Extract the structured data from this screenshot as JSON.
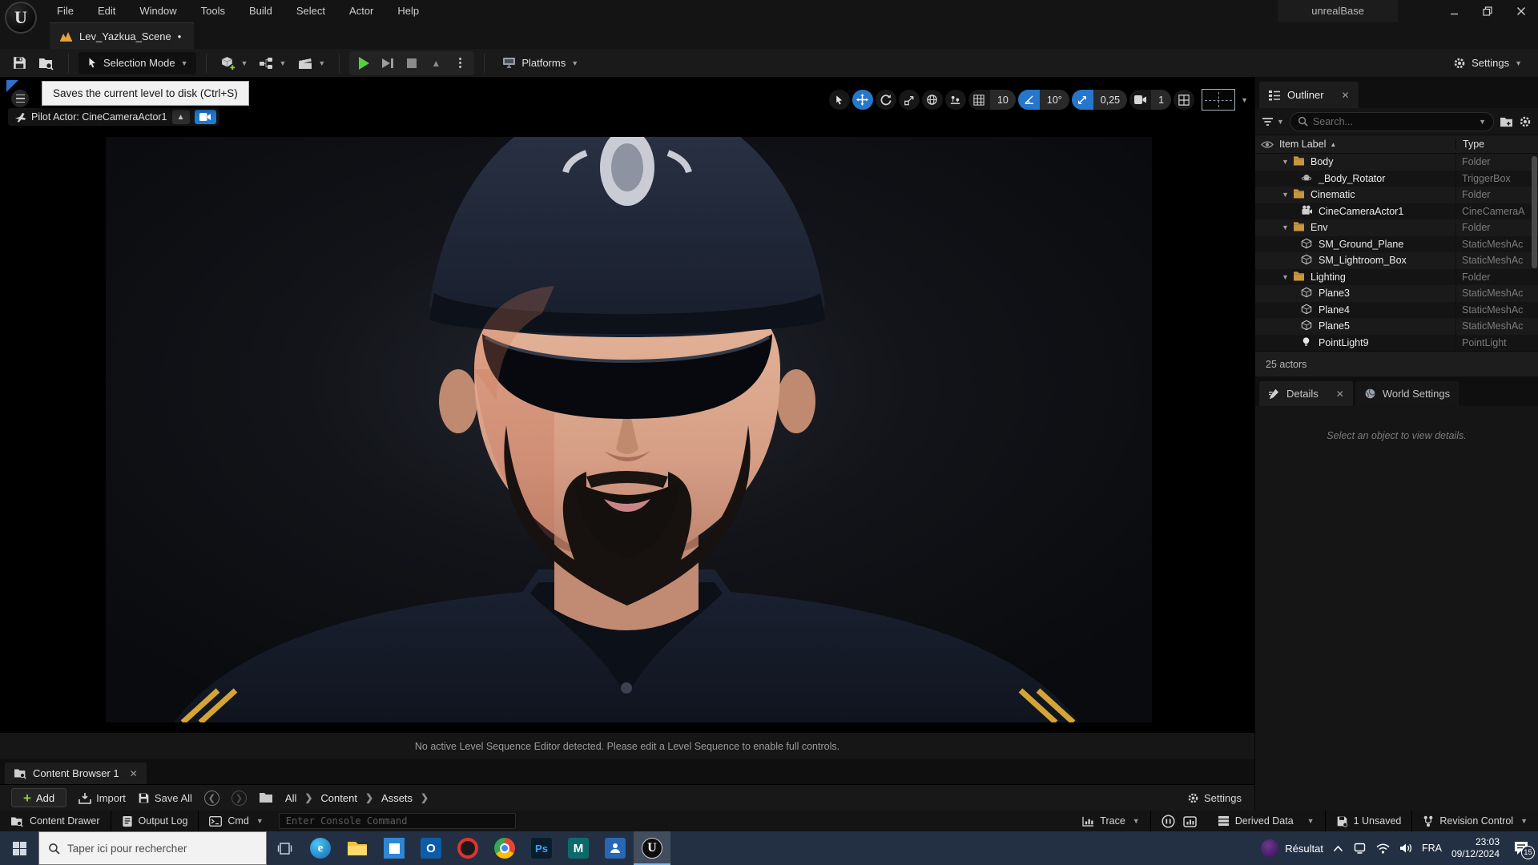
{
  "window": {
    "title": "unrealBase",
    "menus": [
      "File",
      "Edit",
      "Window",
      "Tools",
      "Build",
      "Select",
      "Actor",
      "Help"
    ]
  },
  "level_tab": {
    "label": "Lev_Yazkua_Scene",
    "dirty": "•"
  },
  "toolbar": {
    "selection_mode": "Selection Mode",
    "platforms": "Platforms",
    "settings": "Settings"
  },
  "tooltip": "Saves the current level to disk (Ctrl+S)",
  "viewport": {
    "pilot_label": "Pilot Actor: CineCameraActor1",
    "snap": {
      "grid": "10",
      "rotation": "10°",
      "scale": "0,25",
      "camera_speed": "1"
    },
    "message": "No active Level Sequence Editor detected. Please edit a Level Sequence to enable full controls."
  },
  "outliner": {
    "tab": "Outliner",
    "search_placeholder": "Search...",
    "columns": {
      "item": "Item Label",
      "type": "Type"
    },
    "rows": [
      {
        "label": "Body",
        "type": "Folder",
        "depth": 1,
        "icon": "folder",
        "expanded": true
      },
      {
        "label": "_Body_Rotator",
        "type": "TriggerBox",
        "depth": 2,
        "icon": "trigger"
      },
      {
        "label": "Cinematic",
        "type": "Folder",
        "depth": 1,
        "icon": "folder",
        "expanded": true
      },
      {
        "label": "CineCameraActor1",
        "type": "CineCameraA",
        "depth": 2,
        "icon": "camera"
      },
      {
        "label": "Env",
        "type": "Folder",
        "depth": 1,
        "icon": "folder",
        "expanded": true
      },
      {
        "label": "SM_Ground_Plane",
        "type": "StaticMeshAc",
        "depth": 2,
        "icon": "mesh"
      },
      {
        "label": "SM_Lightroom_Box",
        "type": "StaticMeshAc",
        "depth": 2,
        "icon": "mesh"
      },
      {
        "label": "Lighting",
        "type": "Folder",
        "depth": 1,
        "icon": "folder",
        "expanded": true
      },
      {
        "label": "Plane3",
        "type": "StaticMeshAc",
        "depth": 2,
        "icon": "mesh"
      },
      {
        "label": "Plane4",
        "type": "StaticMeshAc",
        "depth": 2,
        "icon": "mesh"
      },
      {
        "label": "Plane5",
        "type": "StaticMeshAc",
        "depth": 2,
        "icon": "mesh"
      },
      {
        "label": "PointLight9",
        "type": "PointLight",
        "depth": 2,
        "icon": "light"
      }
    ],
    "footer": "25 actors"
  },
  "details": {
    "tab": "Details",
    "world_settings_tab": "World Settings",
    "empty_message": "Select an object to view details."
  },
  "content_browser": {
    "tab": "Content Browser 1",
    "add_label": "Add",
    "import_label": "Import",
    "save_all_label": "Save All",
    "breadcrumbs": [
      "All",
      "Content",
      "Assets"
    ],
    "settings_label": "Settings"
  },
  "status_bar": {
    "content_drawer": "Content Drawer",
    "output_log": "Output Log",
    "cmd": "Cmd",
    "console_placeholder": "Enter Console Command",
    "trace": "Trace",
    "derived_data": "Derived Data",
    "unsaved": "1 Unsaved",
    "revision_control": "Revision Control"
  },
  "taskbar": {
    "search_placeholder": "Taper ici pour rechercher",
    "apps": [
      "microsoft-edge",
      "file-explorer",
      "photos",
      "outlook",
      "opera",
      "chrome",
      "photoshop",
      "maya",
      "character-app",
      "unreal-editor"
    ],
    "active_app": "unreal-editor",
    "tray_app": "Résultat",
    "language": "FRA",
    "time": "23:03",
    "date": "09/12/2024",
    "notification_count": "15"
  },
  "colors": {
    "accent_blue": "#2676c9",
    "play_green": "#57cf3c",
    "add_green": "#8bd13e",
    "folder_orange": "#c8963e",
    "taskbar_blue": "#233044",
    "tooltip_bg": "#f1f1f1"
  }
}
